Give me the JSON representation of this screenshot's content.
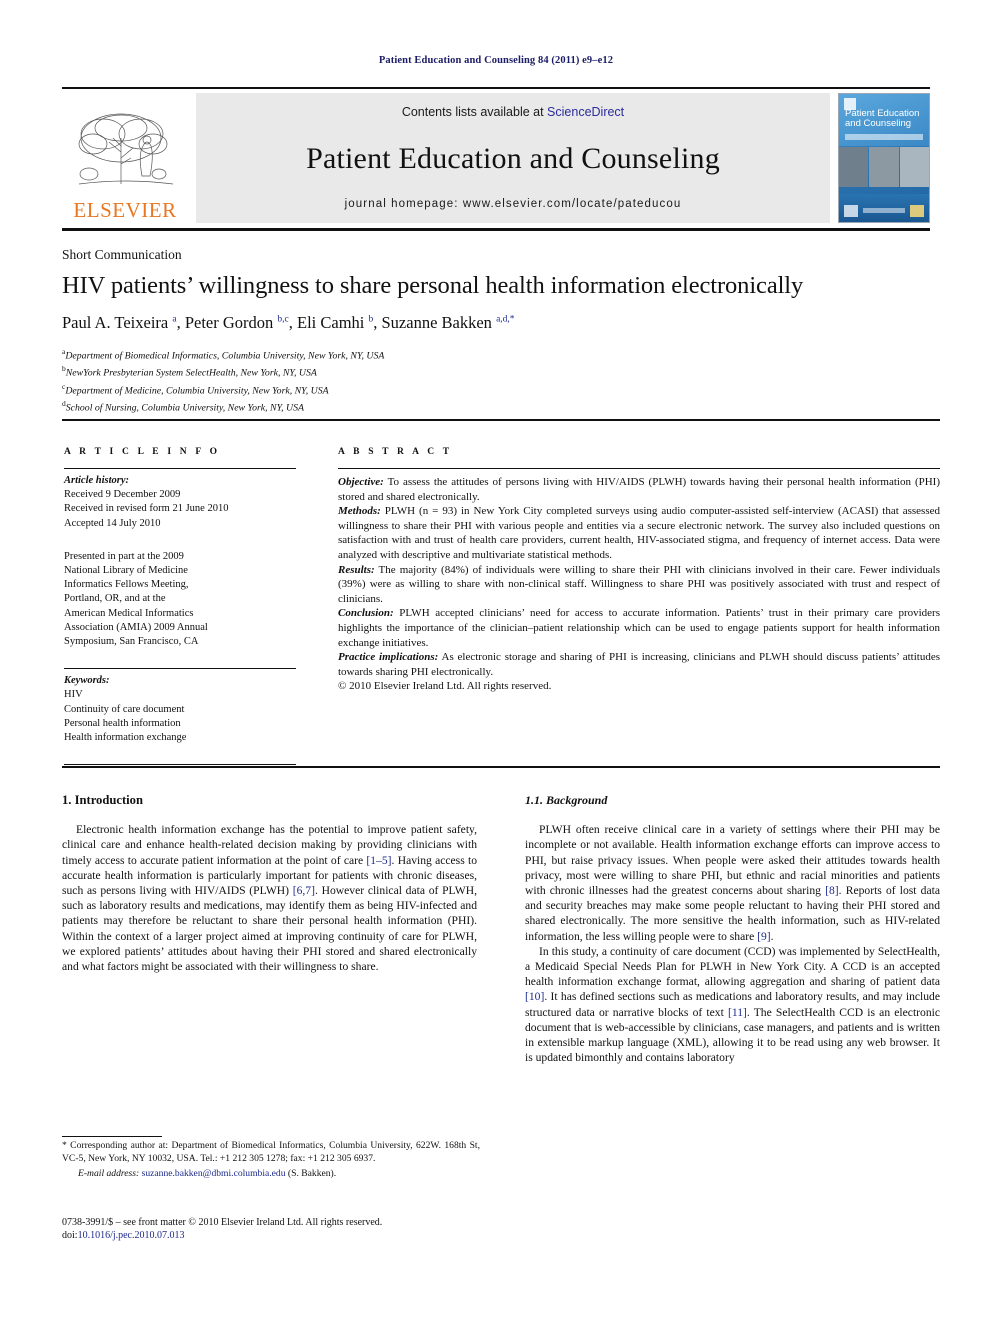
{
  "running_head": "Patient Education and Counseling 84 (2011) e9–e12",
  "masthead": {
    "publisher_logo_text": "ELSEVIER",
    "contents_prefix": "Contents lists available at ",
    "contents_link": "ScienceDirect",
    "journal_title": "Patient Education and Counseling",
    "homepage_line": "journal homepage: www.elsevier.com/locate/pateducou",
    "cover": {
      "title_line1": "Patient Education",
      "title_line2": "and Counseling"
    }
  },
  "article": {
    "section_type": "Short Communication",
    "title": "HIV patients’ willingness to share personal health information electronically",
    "authors_html": "Paul A. Teixeira <sup>a</sup>, Peter Gordon <sup>b,c</sup>, Eli Camhi <sup>b</sup>, Suzanne Bakken <sup>a,d,*</sup>",
    "affiliations": [
      {
        "mark": "a",
        "text": "Department of Biomedical Informatics, Columbia University, New York, NY, USA"
      },
      {
        "mark": "b",
        "text": "NewYork Presbyterian System SelectHealth, New York, NY, USA"
      },
      {
        "mark": "c",
        "text": "Department of Medicine, Columbia University, New York, NY, USA"
      },
      {
        "mark": "d",
        "text": "School of Nursing, Columbia University, New York, NY, USA"
      }
    ]
  },
  "article_info": {
    "heading": "A R T I C L E   I N F O",
    "history_label": "Article history:",
    "history": [
      "Received 9 December 2009",
      "Received in revised form 21 June 2010",
      "Accepted 14 July 2010"
    ],
    "presented": [
      "Presented in part at the 2009",
      "National Library of Medicine",
      "Informatics Fellows Meeting,",
      "Portland, OR, and at the",
      "American Medical Informatics",
      "Association (AMIA) 2009 Annual",
      "Symposium, San Francisco, CA"
    ],
    "keywords_label": "Keywords:",
    "keywords": [
      "HIV",
      "Continuity of care document",
      "Personal health information",
      "Health information exchange"
    ]
  },
  "abstract": {
    "heading": "A B S T R A C T",
    "objective_label": "Objective:",
    "objective": " To assess the attitudes of persons living with HIV/AIDS (PLWH) towards having their personal health information (PHI) stored and shared electronically.",
    "methods_label": "Methods:",
    "methods": " PLWH (n = 93) in New York City completed surveys using audio computer-assisted self-interview (ACASI) that assessed willingness to share their PHI with various people and entities via a secure electronic network. The survey also included questions on satisfaction with and trust of health care providers, current health, HIV-associated stigma, and frequency of internet access. Data were analyzed with descriptive and multivariate statistical methods.",
    "results_label": "Results:",
    "results": " The majority (84%) of individuals were willing to share their PHI with clinicians involved in their care. Fewer individuals (39%) were as willing to share with non-clinical staff. Willingness to share PHI was positively associated with trust and respect of clinicians.",
    "conclusion_label": "Conclusion:",
    "conclusion": " PLWH accepted clinicians’ need for access to accurate information. Patients’ trust in their primary care providers highlights the importance of the clinician–patient relationship which can be used to engage patients support for health information exchange initiatives.",
    "practice_label": "Practice implications:",
    "practice": " As electronic storage and sharing of PHI is increasing, clinicians and PLWH should discuss patients’ attitudes towards sharing PHI electronically.",
    "copyright": "© 2010 Elsevier Ireland Ltd. All rights reserved."
  },
  "body": {
    "left": {
      "heading": "1. Introduction",
      "para1_a": "Electronic health information exchange has the potential to improve patient safety, clinical care and enhance health-related decision making by providing clinicians with timely access to accurate patient information at the point of care ",
      "ref1": "[1–5]",
      "para1_b": ". Having access to accurate health information is particularly important for patients with chronic diseases, such as persons living with HIV/AIDS (PLWH) ",
      "ref2": "[6,7]",
      "para1_c": ". However clinical data of PLWH, such as laboratory results and medications, may identify them as being HIV-infected and patients may therefore be reluctant to share their personal health information (PHI). Within the context of a larger project aimed at improving continuity of care for PLWH, we explored patients’ attitudes about having their PHI stored and shared electronically and what factors might be associated with their willingness to share."
    },
    "right": {
      "heading": "1.1. Background",
      "para1_a": "PLWH often receive clinical care in a variety of settings where their PHI may be incomplete or not available. Health information exchange efforts can improve access to PHI, but raise privacy issues. When people were asked their attitudes towards health privacy, most were willing to share PHI, but ethnic and racial minorities and patients with chronic illnesses had the greatest concerns about sharing ",
      "ref1": "[8]",
      "para1_b": ". Reports of lost data and security breaches may make some people reluctant to having their PHI stored and shared electronically. The more sensitive the health information, such as HIV-related information, the less willing people were to share ",
      "ref2": "[9]",
      "para1_c": ".",
      "para2_a": "In this study, a continuity of care document (CCD) was implemented by SelectHealth, a Medicaid Special Needs Plan for PLWH in New York City. A CCD is an accepted health information exchange format, allowing aggregation and sharing of patient data ",
      "ref3": "[10]",
      "para2_b": ". It has defined sections such as medications and laboratory results, and may include structured data or narrative blocks of text ",
      "ref4": "[11]",
      "para2_c": ". The SelectHealth CCD is an electronic document that is web-accessible by clinicians, case managers, and patients and is written in extensible markup language (XML), allowing it to be read using any web browser. It is updated bimonthly and contains laboratory"
    }
  },
  "footnotes": {
    "corresponding": "* Corresponding author at: Department of Biomedical Informatics, Columbia University, 622W. 168th St, VC-5, New York, NY 10032, USA. Tel.: +1 212 305 1278; fax: +1 212 305 6937.",
    "email_label": "E-mail address:",
    "email": "suzanne.bakken@dbmi.columbia.edu",
    "email_suffix": " (S. Bakken).",
    "issn_line": "0738-3991/$ – see front matter © 2010 Elsevier Ireland Ltd. All rights reserved.",
    "doi_label": "doi:",
    "doi": "10.1016/j.pec.2010.07.013"
  },
  "colors": {
    "running_head": "#1c1c66",
    "elsevier_orange": "#E87722",
    "link_blue": "#1c2a8a",
    "masthead_bg": "#e9e9e9"
  }
}
